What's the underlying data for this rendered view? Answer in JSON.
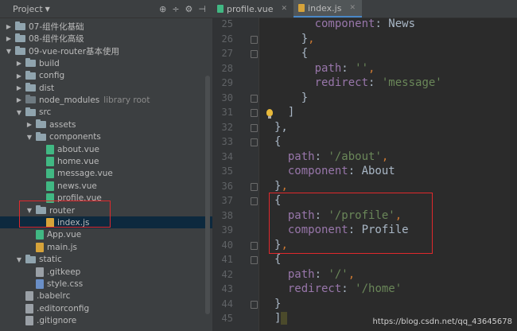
{
  "project_panel": {
    "title": "Project",
    "header_icons": [
      "globe-icon",
      "split-icon",
      "gear-icon",
      "hide-icon"
    ],
    "tree": [
      {
        "label": "07-组件化基础",
        "type": "folder",
        "depth": 0,
        "expanded": false
      },
      {
        "label": "08-组件化高级",
        "type": "folder",
        "depth": 0,
        "expanded": false
      },
      {
        "label": "09-vue-router基本使用",
        "type": "folder",
        "depth": 0,
        "expanded": true
      },
      {
        "label": "build",
        "type": "folder",
        "depth": 1,
        "expanded": false
      },
      {
        "label": "config",
        "type": "folder",
        "depth": 1,
        "expanded": false
      },
      {
        "label": "dist",
        "type": "folder",
        "depth": 1,
        "expanded": false
      },
      {
        "label": "node_modules",
        "type": "folder",
        "depth": 1,
        "expanded": false,
        "extra": "library root"
      },
      {
        "label": "src",
        "type": "folder",
        "depth": 1,
        "expanded": true
      },
      {
        "label": "assets",
        "type": "folder",
        "depth": 2,
        "expanded": false
      },
      {
        "label": "components",
        "type": "folder",
        "depth": 2,
        "expanded": true
      },
      {
        "label": "about.vue",
        "type": "vue",
        "depth": 3
      },
      {
        "label": "home.vue",
        "type": "vue",
        "depth": 3
      },
      {
        "label": "message.vue",
        "type": "vue",
        "depth": 3
      },
      {
        "label": "news.vue",
        "type": "vue",
        "depth": 3
      },
      {
        "label": "profile.vue",
        "type": "vue",
        "depth": 3
      },
      {
        "label": "router",
        "type": "folder",
        "depth": 2,
        "expanded": true
      },
      {
        "label": "index.js",
        "type": "js",
        "depth": 3,
        "selected": true
      },
      {
        "label": "App.vue",
        "type": "vue",
        "depth": 2
      },
      {
        "label": "main.js",
        "type": "js",
        "depth": 2
      },
      {
        "label": "static",
        "type": "folder",
        "depth": 1,
        "expanded": true
      },
      {
        "label": ".gitkeep",
        "type": "gen",
        "depth": 2
      },
      {
        "label": "style.css",
        "type": "css",
        "depth": 2
      },
      {
        "label": ".babelrc",
        "type": "gen",
        "depth": 1
      },
      {
        "label": ".editorconfig",
        "type": "gen",
        "depth": 1
      },
      {
        "label": ".gitignore",
        "type": "gen",
        "depth": 1
      }
    ]
  },
  "tabs": [
    {
      "label": "profile.vue",
      "icon": "vue-file-icon",
      "active": false
    },
    {
      "label": "index.js",
      "icon": "js-file-icon",
      "active": true
    }
  ],
  "code_lines": [
    {
      "num": "25",
      "tokens": [
        [
          "p",
          "      "
        ],
        [
          "k",
          "component"
        ],
        [
          "b",
          ": "
        ],
        [
          "v",
          "News"
        ]
      ]
    },
    {
      "num": "26",
      "tokens": [
        [
          "b",
          "    }"
        ],
        [
          "p",
          ","
        ]
      ]
    },
    {
      "num": "27",
      "tokens": [
        [
          "b",
          "    {"
        ]
      ]
    },
    {
      "num": "28",
      "tokens": [
        [
          "b",
          "      "
        ],
        [
          "k",
          "path"
        ],
        [
          "b",
          ": "
        ],
        [
          "s",
          "''"
        ],
        [
          "p",
          ","
        ]
      ]
    },
    {
      "num": "29",
      "tokens": [
        [
          "b",
          "      "
        ],
        [
          "k",
          "redirect"
        ],
        [
          "b",
          ": "
        ],
        [
          "s",
          "'message'"
        ]
      ]
    },
    {
      "num": "30",
      "tokens": [
        [
          "b",
          "    }"
        ]
      ]
    },
    {
      "num": "31",
      "tokens": [
        [
          "b",
          "  ]"
        ]
      ]
    },
    {
      "num": "32",
      "tokens": [
        [
          "b",
          "},"
        ]
      ]
    },
    {
      "num": "33",
      "tokens": [
        [
          "b",
          "{"
        ]
      ]
    },
    {
      "num": "34",
      "tokens": [
        [
          "b",
          "  "
        ],
        [
          "k",
          "path"
        ],
        [
          "b",
          ": "
        ],
        [
          "s",
          "'/about'"
        ],
        [
          "p",
          ","
        ]
      ]
    },
    {
      "num": "35",
      "tokens": [
        [
          "b",
          "  "
        ],
        [
          "k",
          "component"
        ],
        [
          "b",
          ": "
        ],
        [
          "v",
          "About"
        ]
      ]
    },
    {
      "num": "36",
      "tokens": [
        [
          "b",
          "}"
        ],
        [
          "p",
          ","
        ]
      ]
    },
    {
      "num": "37",
      "tokens": [
        [
          "b",
          "{"
        ]
      ]
    },
    {
      "num": "38",
      "tokens": [
        [
          "b",
          "  "
        ],
        [
          "k",
          "path"
        ],
        [
          "b",
          ": "
        ],
        [
          "s",
          "'/profile'"
        ],
        [
          "p",
          ","
        ]
      ]
    },
    {
      "num": "39",
      "tokens": [
        [
          "b",
          "  "
        ],
        [
          "k",
          "component"
        ],
        [
          "b",
          ": "
        ],
        [
          "v",
          "Profile"
        ]
      ]
    },
    {
      "num": "40",
      "tokens": [
        [
          "b",
          "}"
        ],
        [
          "p",
          ","
        ]
      ]
    },
    {
      "num": "41",
      "tokens": [
        [
          "b",
          "{"
        ]
      ]
    },
    {
      "num": "42",
      "tokens": [
        [
          "b",
          "  "
        ],
        [
          "k",
          "path"
        ],
        [
          "b",
          ": "
        ],
        [
          "s",
          "'/'"
        ],
        [
          "p",
          ","
        ]
      ]
    },
    {
      "num": "43",
      "tokens": [
        [
          "b",
          "  "
        ],
        [
          "k",
          "redirect"
        ],
        [
          "b",
          ": "
        ],
        [
          "s",
          "'/home'"
        ]
      ]
    },
    {
      "num": "44",
      "tokens": [
        [
          "b",
          "}"
        ]
      ]
    },
    {
      "num": "45",
      "tokens": [
        [
          "b",
          "]"
        ]
      ]
    }
  ],
  "watermark": "https://blog.csdn.net/qq_43645678",
  "colors": {
    "highlight_box": "#e0282c",
    "keyword": "#9876aa",
    "string": "#6a8759",
    "punct": "#cc7832"
  }
}
